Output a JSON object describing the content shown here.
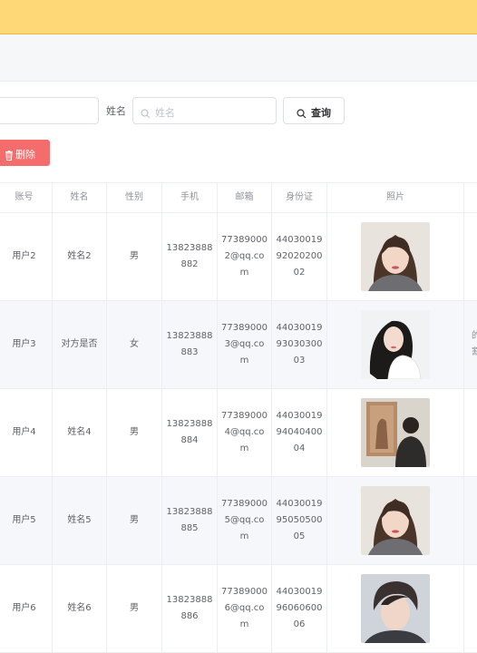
{
  "search": {
    "name_label": "姓名",
    "name_placeholder": "姓名",
    "query_label": "查询"
  },
  "toolbar": {
    "delete_label": "删除"
  },
  "table": {
    "headers": [
      "账号",
      "姓名",
      "性别",
      "手机",
      "邮箱",
      "身份证",
      "照片"
    ],
    "rows": [
      {
        "account": "用户2",
        "name": "姓名2",
        "gender": "男",
        "phone": "13823888882",
        "email": "773890002@qq.com",
        "id_card": "440300199202020002",
        "photo": "portrait-woman-1",
        "extra": ""
      },
      {
        "account": "用户3",
        "name": "对方是否",
        "gender": "女",
        "phone": "13823888883",
        "email": "773890003@qq.com",
        "id_card": "440300199303030003",
        "photo": "portrait-woman-2",
        "extra": "的\n割"
      },
      {
        "account": "用户4",
        "name": "姓名4",
        "gender": "男",
        "phone": "13823888884",
        "email": "773890004@qq.com",
        "id_card": "440300199404040004",
        "photo": "man-at-gallery",
        "extra": ""
      },
      {
        "account": "用户5",
        "name": "姓名5",
        "gender": "男",
        "phone": "13823888885",
        "email": "773890005@qq.com",
        "id_card": "440300199505050005",
        "photo": "portrait-woman-1",
        "extra": ""
      },
      {
        "account": "用户6",
        "name": "姓名6",
        "gender": "男",
        "phone": "13823888886",
        "email": "773890006@qq.com",
        "id_card": "440300199606060006",
        "photo": "portrait-man",
        "extra": ""
      }
    ]
  },
  "colors": {
    "topbar": "#fed776",
    "delete": "#f56c6c",
    "stripe": "#f5f7fa",
    "border": "#ebeef5"
  }
}
